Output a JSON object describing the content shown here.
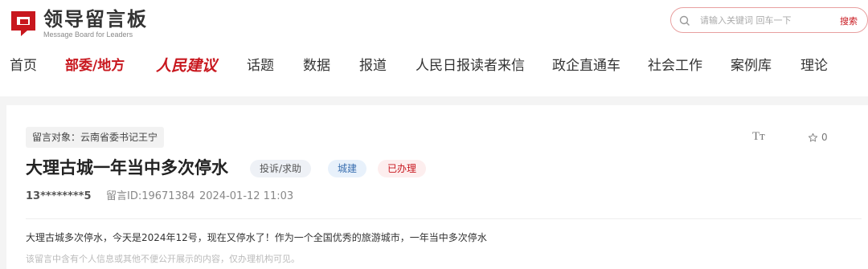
{
  "header": {
    "logo_cn": "领导留言板",
    "logo_en": "Message Board for Leaders",
    "brand_color": "#c8171e"
  },
  "search": {
    "placeholder": "请输入关键词 回车一下",
    "button": "搜索"
  },
  "nav": {
    "items": [
      {
        "label": "首页"
      },
      {
        "label": "部委/地方"
      },
      {
        "label": "人民建议"
      },
      {
        "label": "话题"
      },
      {
        "label": "数据"
      },
      {
        "label": "报道"
      },
      {
        "label": "人民日报读者来信"
      },
      {
        "label": "政企直通车"
      },
      {
        "label": "社会工作"
      },
      {
        "label": "案例库"
      },
      {
        "label": "理论"
      }
    ]
  },
  "message": {
    "target": "留言对象：云南省委书记王宁",
    "title": "大理古城一年当中多次停水",
    "tags": [
      "投诉/求助",
      "城建",
      "已办理"
    ],
    "user": "13********5",
    "id": "留言ID:19671384",
    "time": "2024-01-12 11:03",
    "content": "大理古城多次停水，今天是2024年12号，现在又停水了！作为一个全国优秀的旅游城市，一年当中多次停水",
    "notice": "该留言中含有个人信息或其他不便公开展示的内容，仅办理机构可见。",
    "font_toggle": "Tт",
    "favorite_count": "0"
  }
}
